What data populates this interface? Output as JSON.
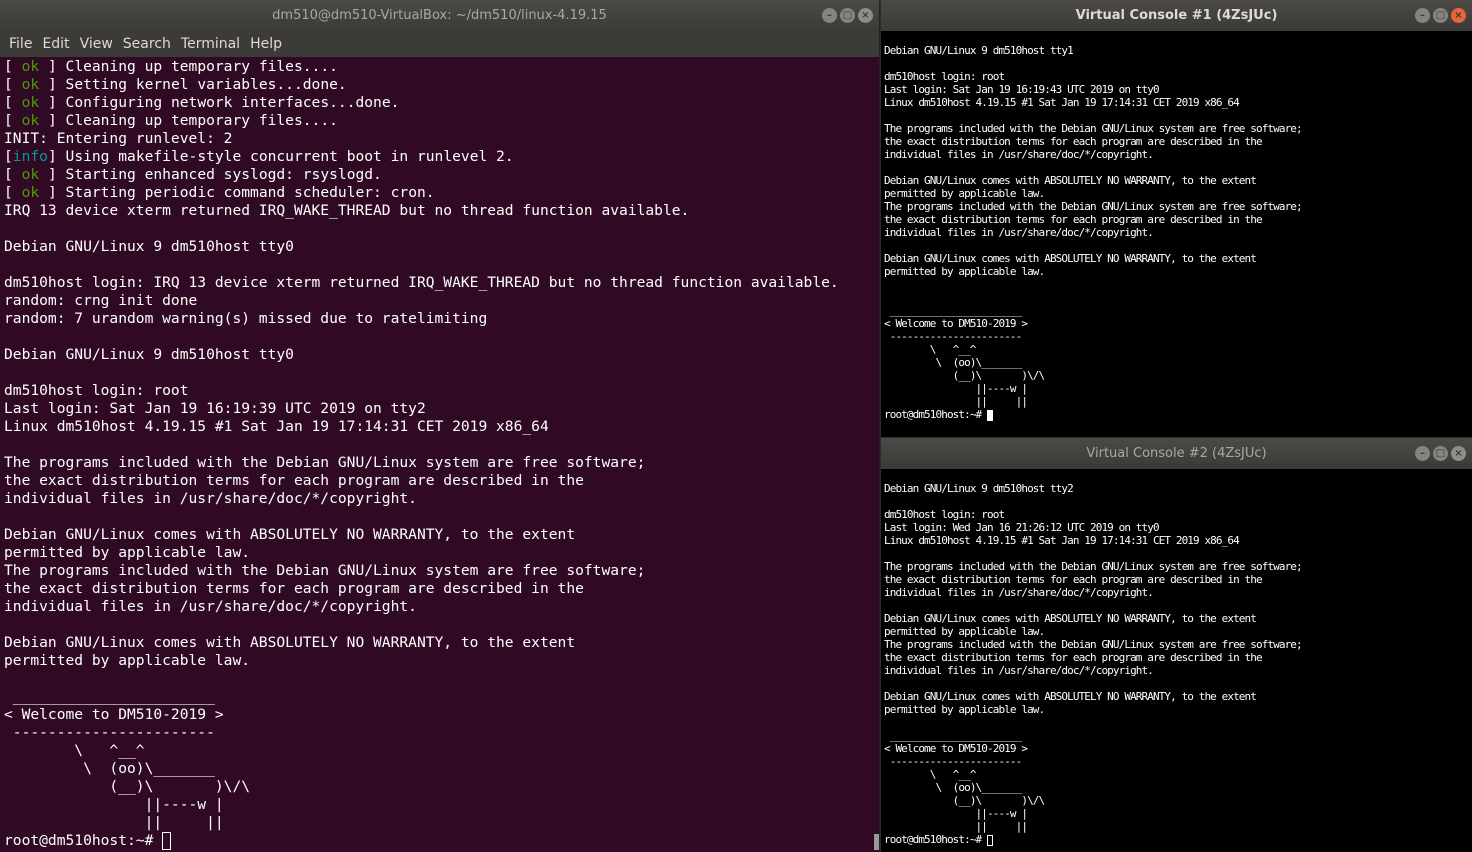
{
  "main_terminal": {
    "title": "dm510@dm510-VirtualBox: ~/dm510/linux-4.19.15",
    "menu": [
      "File",
      "Edit",
      "View",
      "Search",
      "Terminal",
      "Help"
    ],
    "lines": [
      {
        "tag": "ok",
        "text": "Cleaning up temporary files...."
      },
      {
        "tag": "ok",
        "text": "Setting kernel variables...done."
      },
      {
        "tag": "ok",
        "text": "Configuring network interfaces...done."
      },
      {
        "tag": "ok",
        "text": "Cleaning up temporary files...."
      },
      {
        "text": "INIT: Entering runlevel: 2"
      },
      {
        "tag": "info",
        "text": "Using makefile-style concurrent boot in runlevel 2."
      },
      {
        "tag": "ok",
        "text": "Starting enhanced syslogd: rsyslogd."
      },
      {
        "tag": "ok",
        "text": "Starting periodic command scheduler: cron."
      },
      {
        "text": "IRQ 13 device xterm returned IRQ_WAKE_THREAD but no thread function available."
      },
      {
        "text": ""
      },
      {
        "text": "Debian GNU/Linux 9 dm510host tty0"
      },
      {
        "text": ""
      },
      {
        "text": "dm510host login: IRQ 13 device xterm returned IRQ_WAKE_THREAD but no thread function available."
      },
      {
        "text": "random: crng init done"
      },
      {
        "text": "random: 7 urandom warning(s) missed due to ratelimiting"
      },
      {
        "text": ""
      },
      {
        "text": "Debian GNU/Linux 9 dm510host tty0"
      },
      {
        "text": ""
      },
      {
        "text": "dm510host login: root"
      },
      {
        "text": "Last login: Sat Jan 19 16:19:39 UTC 2019 on tty2"
      },
      {
        "text": "Linux dm510host 4.19.15 #1 Sat Jan 19 17:14:31 CET 2019 x86_64"
      },
      {
        "text": ""
      },
      {
        "text": "The programs included with the Debian GNU/Linux system are free software;"
      },
      {
        "text": "the exact distribution terms for each program are described in the"
      },
      {
        "text": "individual files in /usr/share/doc/*/copyright."
      },
      {
        "text": ""
      },
      {
        "text": "Debian GNU/Linux comes with ABSOLUTELY NO WARRANTY, to the extent"
      },
      {
        "text": "permitted by applicable law."
      },
      {
        "text": "The programs included with the Debian GNU/Linux system are free software;"
      },
      {
        "text": "the exact distribution terms for each program are described in the"
      },
      {
        "text": "individual files in /usr/share/doc/*/copyright."
      },
      {
        "text": ""
      },
      {
        "text": "Debian GNU/Linux comes with ABSOLUTELY NO WARRANTY, to the extent"
      },
      {
        "text": "permitted by applicable law."
      },
      {
        "text": ""
      },
      {
        "text": " _______________________"
      },
      {
        "text": "< Welcome to DM510-2019 >"
      },
      {
        "text": " -----------------------"
      },
      {
        "text": "        \\   ^__^"
      },
      {
        "text": "         \\  (oo)\\_______"
      },
      {
        "text": "            (__)\\       )\\/\\"
      },
      {
        "text": "                ||----w |"
      },
      {
        "text": "                ||     ||"
      }
    ],
    "prompt": "root@dm510host:~# "
  },
  "vc1": {
    "title": "Virtual Console #1 (4ZsJUc)",
    "lines": [
      "",
      "Debian GNU/Linux 9 dm510host tty1",
      "",
      "dm510host login: root",
      "Last login: Sat Jan 19 16:19:43 UTC 2019 on tty0",
      "Linux dm510host 4.19.15 #1 Sat Jan 19 17:14:31 CET 2019 x86_64",
      "",
      "The programs included with the Debian GNU/Linux system are free software;",
      "the exact distribution terms for each program are described in the",
      "individual files in /usr/share/doc/*/copyright.",
      "",
      "Debian GNU/Linux comes with ABSOLUTELY NO WARRANTY, to the extent",
      "permitted by applicable law.",
      "The programs included with the Debian GNU/Linux system are free software;",
      "the exact distribution terms for each program are described in the",
      "individual files in /usr/share/doc/*/copyright.",
      "",
      "Debian GNU/Linux comes with ABSOLUTELY NO WARRANTY, to the extent",
      "permitted by applicable law.",
      "",
      "",
      " _______________________",
      "< Welcome to DM510-2019 >",
      " -----------------------",
      "        \\   ^__^",
      "         \\  (oo)\\_______",
      "            (__)\\       )\\/\\",
      "                ||----w |",
      "                ||     ||"
    ],
    "prompt": "root@dm510host:~# "
  },
  "vc2": {
    "title": "Virtual Console #2 (4ZsJUc)",
    "lines": [
      "",
      "Debian GNU/Linux 9 dm510host tty2",
      "",
      "dm510host login: root",
      "Last login: Wed Jan 16 21:26:12 UTC 2019 on tty0",
      "Linux dm510host 4.19.15 #1 Sat Jan 19 17:14:31 CET 2019 x86_64",
      "",
      "The programs included with the Debian GNU/Linux system are free software;",
      "the exact distribution terms for each program are described in the",
      "individual files in /usr/share/doc/*/copyright.",
      "",
      "Debian GNU/Linux comes with ABSOLUTELY NO WARRANTY, to the extent",
      "permitted by applicable law.",
      "The programs included with the Debian GNU/Linux system are free software;",
      "the exact distribution terms for each program are described in the",
      "individual files in /usr/share/doc/*/copyright.",
      "",
      "Debian GNU/Linux comes with ABSOLUTELY NO WARRANTY, to the extent",
      "permitted by applicable law.",
      "",
      " _______________________",
      "< Welcome to DM510-2019 >",
      " -----------------------",
      "        \\   ^__^",
      "         \\  (oo)\\_______",
      "            (__)\\       )\\/\\",
      "                ||----w |",
      "                ||     ||"
    ],
    "prompt": "root@dm510host:~# "
  },
  "window_controls": {
    "minimize": "–",
    "maximize": "□",
    "close": "×"
  }
}
